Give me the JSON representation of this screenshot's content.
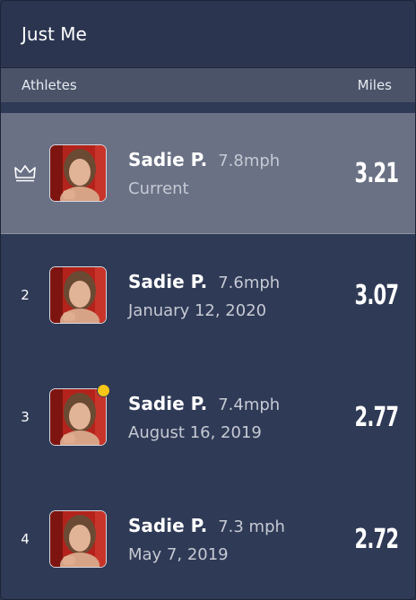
{
  "title": "Just Me",
  "header": {
    "athletes_label": "Athletes",
    "miles_label": "Miles"
  },
  "rows": [
    {
      "rank_icon": "crown-icon",
      "name": "Sadie P.",
      "speed": "7.8mph",
      "subtitle": "Current",
      "miles": "3.21",
      "highlighted": true
    },
    {
      "rank": "2",
      "name": "Sadie P.",
      "speed": "7.6mph",
      "subtitle": "January 12, 2020",
      "miles": "3.07"
    },
    {
      "rank": "3",
      "name": "Sadie P.",
      "speed": "7.4mph",
      "subtitle": "August 16, 2019",
      "miles": "2.77",
      "status_dot_color": "#f5c518"
    },
    {
      "rank": "4",
      "name": "Sadie P.",
      "speed": "7.3 mph",
      "subtitle": "May 7, 2019",
      "miles": "2.72"
    }
  ],
  "colors": {
    "background": "#2f3a56",
    "highlight": "#6a7184",
    "header": "#4a5368",
    "accent_dot": "#f5c518"
  }
}
